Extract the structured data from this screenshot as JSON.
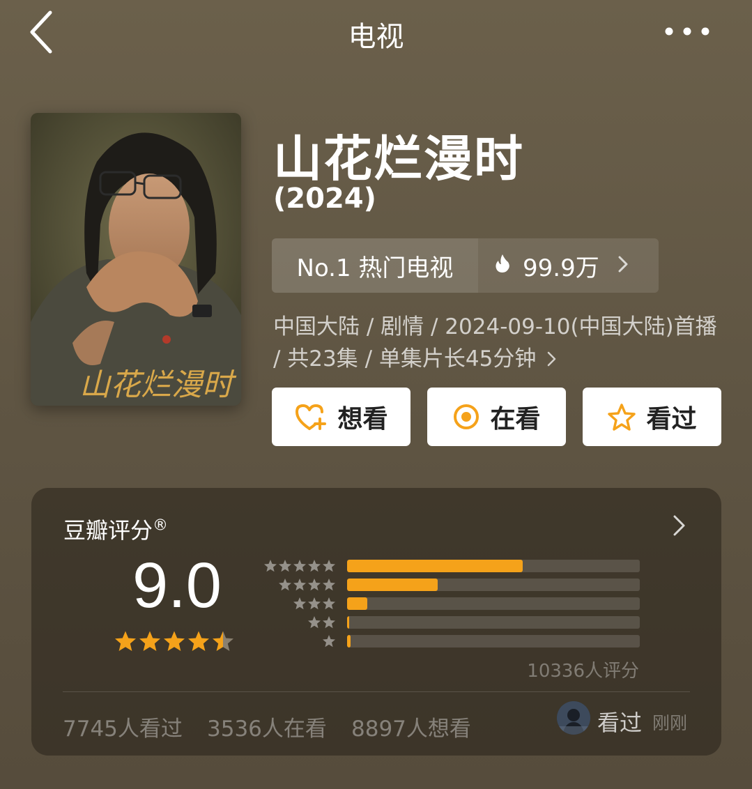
{
  "header": {
    "title": "电视",
    "back_icon": "chevron-left-icon",
    "more_icon": "more-dots-icon"
  },
  "poster": {
    "calligraphy": "山花烂漫时"
  },
  "title": {
    "name": "山花烂漫时",
    "year": "(2024)"
  },
  "rank": {
    "label": "No.1 热门电视",
    "heat": "99.9万",
    "heat_icon": "flame-icon"
  },
  "meta": {
    "line": "中国大陆 / 剧情 / 2024-09-10(中国大陆)首播 / 共23集 / 单集片长45分钟"
  },
  "actions": {
    "want": "想看",
    "watching": "在看",
    "watched": "看过",
    "icon_color": "#f5a21a"
  },
  "rating": {
    "header": "豆瓣评分",
    "registered": "®",
    "score": "9.0",
    "stars": 4.5,
    "distribution": [
      {
        "stars": 5,
        "fraction": 0.6
      },
      {
        "stars": 4,
        "fraction": 0.31
      },
      {
        "stars": 3,
        "fraction": 0.07
      },
      {
        "stars": 2,
        "fraction": 0.008
      },
      {
        "stars": 1,
        "fraction": 0.012
      }
    ],
    "count": "10336人评分",
    "accent": "#f5a21a"
  },
  "stats": {
    "watched": "7745人看过",
    "watching": "3536人在看",
    "want": "8897人想看"
  },
  "friend": {
    "action": "看过",
    "time": "刚刚"
  }
}
